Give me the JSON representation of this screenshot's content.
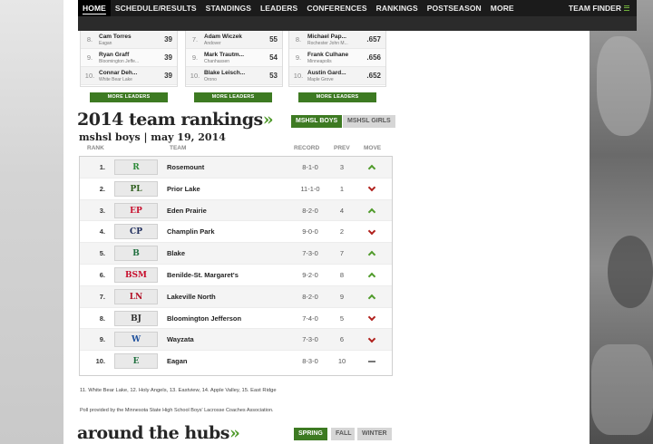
{
  "nav": {
    "items": [
      "HOME",
      "SCHEDULE/RESULTS",
      "STANDINGS",
      "LEADERS",
      "CONFERENCES",
      "RANKINGS",
      "POSTSEASON",
      "MORE"
    ],
    "team_finder": "TEAM FINDER"
  },
  "leaders": [
    {
      "rows": [
        {
          "rank": "8.",
          "name": "Cam Torres",
          "school": "Eagan",
          "value": "39"
        },
        {
          "rank": "9.",
          "name": "Ryan Graff",
          "school": "Bloomington Jeffe...",
          "value": "39"
        },
        {
          "rank": "10.",
          "name": "Connar Deh...",
          "school": "White Bear Lake",
          "value": "39"
        }
      ],
      "more": "MORE LEADERS"
    },
    {
      "rows": [
        {
          "rank": "7.",
          "name": "Adam Wiczek",
          "school": "Andover",
          "value": "55"
        },
        {
          "rank": "9.",
          "name": "Mark Trautm...",
          "school": "Chanhassen",
          "value": "54"
        },
        {
          "rank": "10.",
          "name": "Blake Leisch...",
          "school": "Orono",
          "value": "53"
        }
      ],
      "more": "MORE LEADERS"
    },
    {
      "rows": [
        {
          "rank": "8.",
          "name": "Michael Pap...",
          "school": "Rochester John M...",
          "value": ".657"
        },
        {
          "rank": "9.",
          "name": "Frank Culhane",
          "school": "Minneapolis",
          "value": ".656"
        },
        {
          "rank": "10.",
          "name": "Austin Gard...",
          "school": "Maple Grove",
          "value": ".652"
        }
      ],
      "more": "MORE LEADERS"
    }
  ],
  "rankings": {
    "title": "2014 team rankings",
    "raquo": "»",
    "toggle_boys": "MSHSL BOYS",
    "toggle_girls": "MSHSL GIRLS",
    "subtitle": "mshsl boys | may 19, 2014",
    "headers": {
      "rank": "RANK",
      "team": "TEAM",
      "record": "RECORD",
      "prev": "PREV",
      "move": "MOVE"
    },
    "rows": [
      {
        "rank": "1.",
        "team": "Rosemount",
        "record": "8-1-0",
        "prev": "3",
        "move": "up",
        "logo": "R",
        "logo_color": "#2e8b3a"
      },
      {
        "rank": "2.",
        "team": "Prior Lake",
        "record": "11-1-0",
        "prev": "1",
        "move": "down",
        "logo": "PL",
        "logo_color": "#2f5e1e"
      },
      {
        "rank": "3.",
        "team": "Eden Prairie",
        "record": "8-2-0",
        "prev": "4",
        "move": "up",
        "logo": "EP",
        "logo_color": "#c8102e"
      },
      {
        "rank": "4.",
        "team": "Champlin Park",
        "record": "9-0-0",
        "prev": "2",
        "move": "down",
        "logo": "CP",
        "logo_color": "#1c2a5a"
      },
      {
        "rank": "5.",
        "team": "Blake",
        "record": "7-3-0",
        "prev": "7",
        "move": "up",
        "logo": "B",
        "logo_color": "#1f6f3e"
      },
      {
        "rank": "6.",
        "team": "Benilde-St. Margaret's",
        "record": "9-2-0",
        "prev": "8",
        "move": "up",
        "logo": "BSM",
        "logo_color": "#c8102e"
      },
      {
        "rank": "7.",
        "team": "Lakeville North",
        "record": "8-2-0",
        "prev": "9",
        "move": "up",
        "logo": "LN",
        "logo_color": "#b3142a"
      },
      {
        "rank": "8.",
        "team": "Bloomington Jefferson",
        "record": "7-4-0",
        "prev": "5",
        "move": "down",
        "logo": "BJ",
        "logo_color": "#333333"
      },
      {
        "rank": "9.",
        "team": "Wayzata",
        "record": "7-3-0",
        "prev": "6",
        "move": "down",
        "logo": "W",
        "logo_color": "#1d4f9c"
      },
      {
        "rank": "10.",
        "team": "Eagan",
        "record": "8-3-0",
        "prev": "10",
        "move": "same",
        "logo": "E",
        "logo_color": "#1f6f3e"
      }
    ],
    "honorable": "11. White Bear Lake, 12. Holy Angels, 13. Eastview, 14. Apple Valley, 15. East Ridge",
    "poll_note": "Poll provided by the Minnesota State High School Boys' Lacrosse Coaches Association."
  },
  "hubs": {
    "title": "around the hubs",
    "raquo": "»",
    "seasons": [
      "SPRING",
      "FALL",
      "WINTER"
    ]
  },
  "colors": {
    "accent": "#3d7a22",
    "up": "#4f9a2a",
    "down": "#b0201c"
  }
}
